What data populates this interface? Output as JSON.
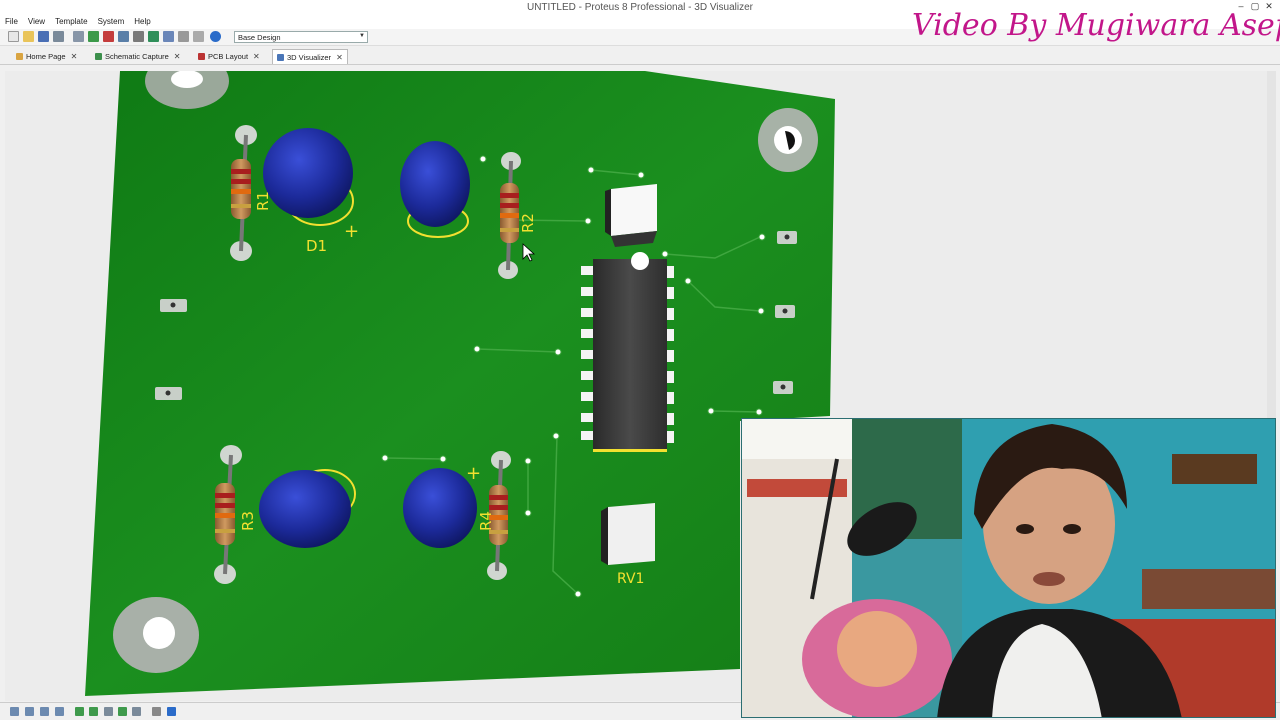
{
  "window": {
    "title": "UNTITLED - Proteus 8 Professional - 3D Visualizer"
  },
  "menu": {
    "items": [
      "File",
      "View",
      "Template",
      "System",
      "Help"
    ]
  },
  "toolbar": {
    "design_select": "Base Design"
  },
  "tabs": [
    {
      "label": "Home Page",
      "icon": "home-icon",
      "closable": true,
      "active": false
    },
    {
      "label": "Schematic Capture",
      "icon": "schematic-icon",
      "closable": true,
      "active": false
    },
    {
      "label": "PCB Layout",
      "icon": "pcb-icon",
      "closable": true,
      "active": false
    },
    {
      "label": "3D Visualizer",
      "icon": "3d-visualizer-icon",
      "closable": true,
      "active": true
    }
  ],
  "board": {
    "silkscreen": [
      "R1",
      "D1",
      "+",
      "R2",
      "R3",
      "R4",
      "+",
      "RV1"
    ],
    "color": "#128a12",
    "led_color": "#1c2a9a"
  },
  "watermark": "Video By Mugiwara Asep",
  "colors": {
    "board_green": "#128a12",
    "silkscreen": "#f2e030",
    "watermark": "#c2168a"
  }
}
